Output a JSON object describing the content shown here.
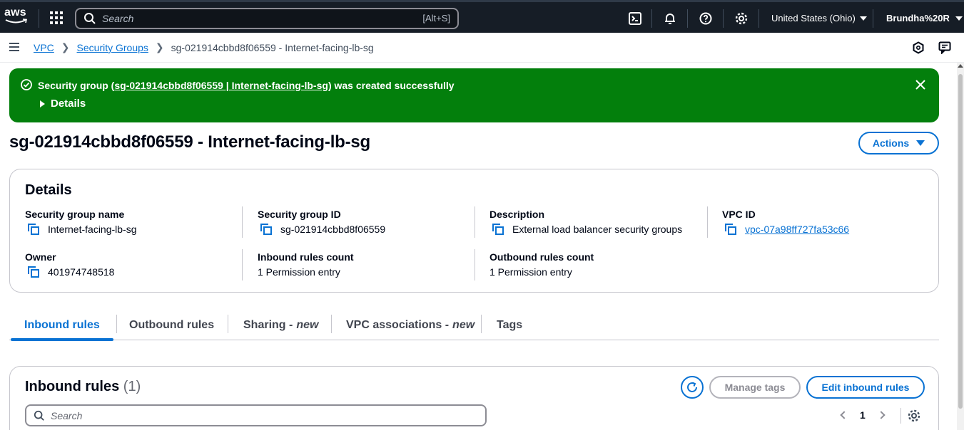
{
  "topnav": {
    "logo_text": "aws",
    "search_placeholder": "Search",
    "search_shortcut": "[Alt+S]",
    "region": "United States (Ohio)",
    "user": "Brundha%20R"
  },
  "breadcrumb": {
    "items": [
      "VPC",
      "Security Groups"
    ],
    "current": "sg-021914cbbd8f06559 - Internet-facing-lb-sg"
  },
  "flash": {
    "prefix": "Security group (",
    "link": "sg-021914cbbd8f06559 | Internet-facing-lb-sg",
    "suffix": ") was created successfully",
    "details_label": "Details",
    "color": "#037f0c"
  },
  "page": {
    "title": "sg-021914cbbd8f06559 - Internet-facing-lb-sg",
    "actions_label": "Actions"
  },
  "details": {
    "heading": "Details",
    "fields": [
      {
        "label": "Security group name",
        "value": "Internet-facing-lb-sg"
      },
      {
        "label": "Security group ID",
        "value": "sg-021914cbbd8f06559"
      },
      {
        "label": "Description",
        "value": "External load balancer security groups"
      },
      {
        "label": "VPC ID",
        "value": "vpc-07a98ff727fa53c66"
      },
      {
        "label": "Owner",
        "value": "401974748518"
      },
      {
        "label": "Inbound rules count",
        "value": "1 Permission entry"
      },
      {
        "label": "Outbound rules count",
        "value": "1 Permission entry"
      }
    ]
  },
  "tabs": [
    {
      "label": "Inbound rules",
      "suffix": ""
    },
    {
      "label": "Outbound rules",
      "suffix": ""
    },
    {
      "label": "Sharing -",
      "suffix": "new"
    },
    {
      "label": "VPC associations -",
      "suffix": "new"
    },
    {
      "label": "Tags",
      "suffix": ""
    }
  ],
  "inbound": {
    "heading": "Inbound rules",
    "count": "(1)",
    "manage_tags_label": "Manage tags",
    "edit_label": "Edit inbound rules",
    "search_placeholder": "Search",
    "page_number": "1"
  },
  "colors": {
    "accent": "#0972d3",
    "nav_bg": "#161d26",
    "success": "#037f0c"
  }
}
